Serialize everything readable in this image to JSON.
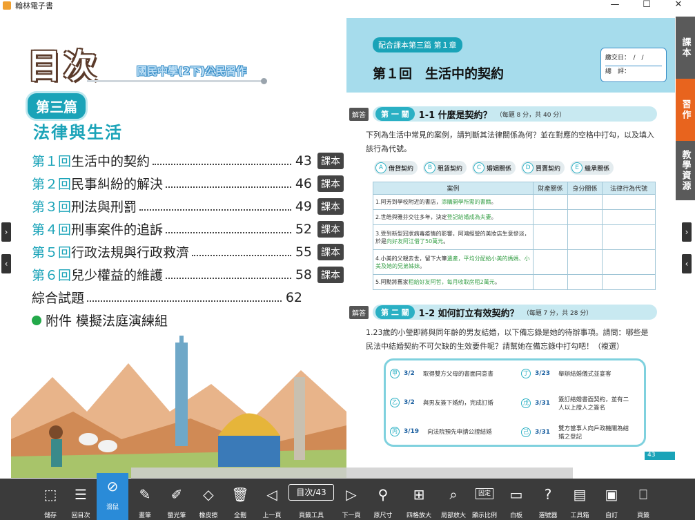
{
  "window": {
    "title": "翰林電子書",
    "controls": [
      "—",
      "☐",
      "✕"
    ]
  },
  "left_page": {
    "toc_title": "目次",
    "subtitle": "國民中學(2下)公民習作",
    "part_badge": "第三篇",
    "part_title": "法律與生活",
    "chapters": [
      {
        "num": "第１回",
        "title": "生活中的契約",
        "page": "43",
        "tag": "課本"
      },
      {
        "num": "第２回",
        "title": "民事糾紛的解決",
        "page": "46",
        "tag": "課本"
      },
      {
        "num": "第３回",
        "title": "刑法與刑罰",
        "page": "49",
        "tag": "課本"
      },
      {
        "num": "第４回",
        "title": "刑事案件的追訴",
        "page": "52",
        "tag": "課本"
      },
      {
        "num": "第５回",
        "title": "行政法規與行政救濟",
        "page": "55",
        "tag": "課本"
      },
      {
        "num": "第６回",
        "title": "兒少權益的維護",
        "page": "58",
        "tag": "課本"
      }
    ],
    "review": {
      "title": "綜合試題",
      "page": "62"
    },
    "appendix": "附件 模擬法庭演練組"
  },
  "right_page": {
    "chapter_tag": "配合課本第三篇 第１章",
    "title": "第１回　生活中的契約",
    "box_labels": [
      "繳交日：　/　/",
      "總　評："
    ],
    "answer_label": "解答",
    "sections": [
      {
        "badge": "第 一 關",
        "text": "1-1 什麼是契約？",
        "meta": "（每題 8 分，共 40 分）"
      },
      {
        "badge": "第 二 關",
        "text": "1-2 如何訂立有效契約？",
        "meta": "（每題 7 分，共 28 分）"
      }
    ],
    "para1": "下列為生活中常見的案例，請判斷其法律關係為何？並在對應的空格中打勾，以及填入該行為代號。",
    "options": [
      {
        "letter": "A",
        "label": "借貸契約"
      },
      {
        "letter": "B",
        "label": "租賃契約"
      },
      {
        "letter": "C",
        "label": "婚姻關係"
      },
      {
        "letter": "D",
        "label": "買賣契約"
      },
      {
        "letter": "E",
        "label": "繼承關係"
      }
    ],
    "table": {
      "headers": [
        "案例",
        "財產關係",
        "身分關係",
        "法律行為代號"
      ],
      "rows": [
        {
          "plain": "1.阿芳到學校附近的書店，",
          "green": "添購開學所需的書籍",
          "tail": "。"
        },
        {
          "plain": "2.世皓與雅芬交往多年，決定",
          "green": "登記結婚成為夫妻",
          "tail": "。"
        },
        {
          "plain": "3.受到新型冠狀病毒疫情的影響，阿鴻經營的美妝店生意慘淡，於是",
          "green": "向好友阿江借了50萬元",
          "tail": "。"
        },
        {
          "plain": "4.小美的父親去世，留下大筆",
          "green": "遺產，平均分配給小美的媽媽、小美及她的兄弟姊妹",
          "tail": "。"
        },
        {
          "plain": "5.阿勳將舊家",
          "green": "租給好友阿哲，每月收取房租2萬元",
          "tail": "。"
        }
      ]
    },
    "para2": "1.23歲的小瑩即將與同年齡的男友結婚，以下備忘錄是她的待辦事項。請問：哪些是民法中結婚契約不可欠缺的生效要件呢？請幫她在備忘錄中打勾吧！（複選）",
    "memo": [
      {
        "letter": "甲",
        "date": "3/2",
        "text": "取得雙方父母的書面同意書"
      },
      {
        "letter": "丁",
        "date": "3/23",
        "text": "舉辦結婚儀式並宴客"
      },
      {
        "letter": "乙",
        "date": "3/2",
        "text": "與男友簽下婚約，完成訂婚"
      },
      {
        "letter": "戊",
        "date": "3/31",
        "text": "簽訂結婚書面契約，並有二人以上證人之簽名"
      },
      {
        "letter": "丙",
        "date": "3/19",
        "text": "向法院預先申請公證結婚"
      },
      {
        "letter": "己",
        "date": "3/31",
        "text": "雙方當事人向戶政機關為結婚之登記"
      }
    ],
    "page_number": "43"
  },
  "side_tabs": [
    {
      "label": "課本",
      "color": "#5a5a5a"
    },
    {
      "label": "習作",
      "color": "#e8641e"
    },
    {
      "label": "教學資源",
      "color": "#5a5a5a"
    }
  ],
  "toolbar": {
    "page_box": "目次/43",
    "items": [
      {
        "name": "save",
        "icon": "⬚",
        "label": "儲存"
      },
      {
        "name": "toc",
        "icon": "☰",
        "label": "回目次"
      },
      {
        "name": "mouse",
        "icon": "⊘",
        "label": "滑鼠"
      },
      {
        "name": "pen",
        "icon": "✎",
        "label": "畫筆"
      },
      {
        "name": "highlighter",
        "icon": "✐",
        "label": "螢光筆"
      },
      {
        "name": "eraser",
        "icon": "◇",
        "label": "橡皮擦"
      },
      {
        "name": "clear",
        "icon": "🗑",
        "label": "全刪"
      },
      {
        "name": "prev",
        "icon": "◁",
        "label": "上一頁"
      },
      {
        "name": "page-tools",
        "icon": "",
        "label": "頁籤工具"
      },
      {
        "name": "next",
        "icon": "▷",
        "label": "下一頁"
      },
      {
        "name": "original-size",
        "icon": "⚲",
        "label": "原尺寸"
      },
      {
        "name": "quad-zoom",
        "icon": "⊞",
        "label": "四格放大"
      },
      {
        "name": "partial-zoom",
        "icon": "⌕",
        "label": "局部放大"
      },
      {
        "name": "ratio",
        "icon": "▭",
        "label": "顯示比例"
      },
      {
        "name": "whiteboard",
        "icon": "▭",
        "label": "白板"
      },
      {
        "name": "picker",
        "icon": "?",
        "label": "選號器"
      },
      {
        "name": "toolbox",
        "icon": "▤",
        "label": "工具箱"
      },
      {
        "name": "bookmark",
        "icon": "▣",
        "label": "自訂"
      },
      {
        "name": "page",
        "icon": "⎕",
        "label": "頁籤"
      }
    ],
    "ratio_label": "固定"
  }
}
